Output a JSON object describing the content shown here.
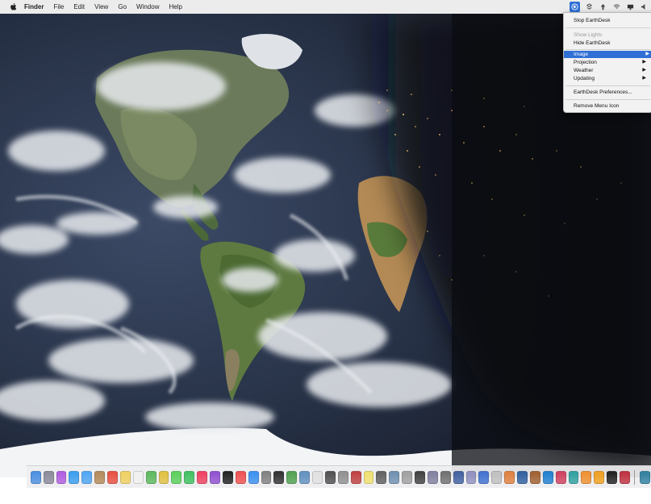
{
  "menubar": {
    "app_name": "Finder",
    "menus": [
      "File",
      "Edit",
      "View",
      "Go",
      "Window",
      "Help"
    ]
  },
  "dropdown": {
    "items": [
      {
        "label": "Stop EarthDesk",
        "state": "normal"
      },
      {
        "label": "Show Lights",
        "state": "disabled"
      },
      {
        "label": "Hide EarthDesk",
        "state": "normal"
      },
      {
        "label": "Image",
        "state": "selected",
        "submenu": true
      },
      {
        "label": "Projection",
        "state": "normal",
        "submenu": true
      },
      {
        "label": "Weather",
        "state": "normal",
        "submenu": true
      },
      {
        "label": "Updating",
        "state": "normal",
        "submenu": true
      },
      {
        "label": "EarthDesk Preferences...",
        "state": "normal"
      },
      {
        "label": "Remove Menu Icon",
        "state": "normal"
      }
    ]
  },
  "colors": {
    "menubar_bg": "#ececec",
    "highlight": "#2f6fd6",
    "ocean_day": "#2a3550",
    "night": "#0d0f15"
  },
  "dock": {
    "icons": [
      "finder-icon",
      "launchpad-icon",
      "siri-icon",
      "safari-icon",
      "mail-icon",
      "contacts-icon",
      "calendar-icon",
      "notes-icon",
      "reminders-icon",
      "maps-icon",
      "photos-icon",
      "messages-icon",
      "facetime-icon",
      "music-icon",
      "podcasts-icon",
      "tv-icon",
      "news-icon",
      "app-store-icon",
      "system-preferences-icon",
      "terminal-icon",
      "activity-monitor-icon",
      "preview-icon",
      "textedit-icon",
      "calculator-icon",
      "font-book-icon",
      "dictionary-icon",
      "stickies-icon",
      "chess-icon",
      "image-capture-icon",
      "screenshot-icon",
      "console-icon",
      "disk-utility-icon",
      "keychain-icon",
      "grapher-icon",
      "migration-icon",
      "bluetooth-icon",
      "airport-icon",
      "colorsync-icon",
      "voiceover-icon",
      "automator-icon",
      "quicktime-icon",
      "photo-booth-icon",
      "time-machine-icon",
      "books-icon",
      "home-icon",
      "stocks-icon",
      "voice-memos-icon",
      "earthdesk-icon"
    ],
    "icon_colors": [
      "#4a8fe0",
      "#8a8a9a",
      "#b05ce0",
      "#3a9ef0",
      "#4fa6f5",
      "#b38a5a",
      "#e85040",
      "#f0d060",
      "#f0f0f0",
      "#5cb85c",
      "#e0c040",
      "#5ad05a",
      "#40c060",
      "#f04060",
      "#9050d0",
      "#202020",
      "#f05050",
      "#3a90f0",
      "#808080",
      "#303030",
      "#50a050",
      "#6090c0",
      "#e0e0e0",
      "#505050",
      "#909090",
      "#c04040",
      "#f0e070",
      "#606060",
      "#7090b0",
      "#a0a0a0",
      "#404040",
      "#8080a0",
      "#707070",
      "#4060a0",
      "#9090c0",
      "#4070d0",
      "#c0c0c0",
      "#e08040",
      "#3060a0",
      "#a06030",
      "#2080d0",
      "#d04060",
      "#30a0a0",
      "#f09030",
      "#f0a020",
      "#202020",
      "#c03040",
      "#3080a0"
    ]
  }
}
